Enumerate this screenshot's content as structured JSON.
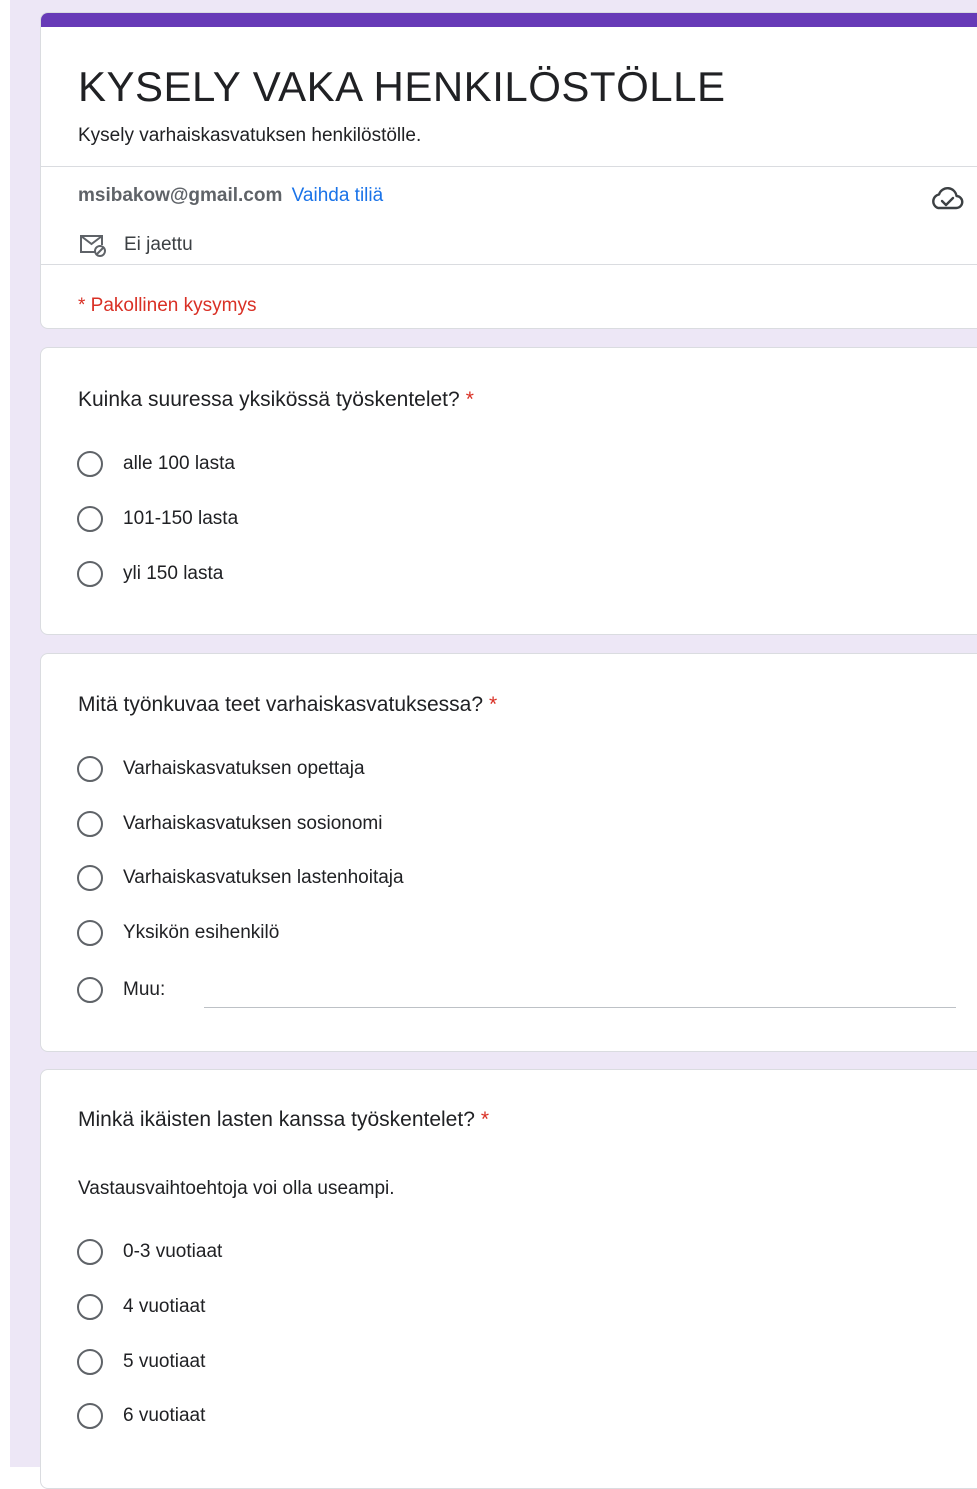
{
  "form": {
    "title": "KYSELY VAKA HENKILÖSTÖLLE",
    "description": "Kysely varhaiskasvatuksen henkilöstölle."
  },
  "account": {
    "email": "msibakow@gmail.com",
    "switch_label": "Vaihda tiliä",
    "share_status": "Ei jaettu",
    "cloud_icon": "cloud-saved-icon",
    "share_icon": "mail-not-shared-icon"
  },
  "required_note": "* Pakollinen kysymys",
  "required_star": "*",
  "questions": [
    {
      "title": "Kuinka suuressa yksikössä työskentelet?",
      "options": [
        "alle 100 lasta",
        "101-150 lasta",
        "yli 150 lasta"
      ]
    },
    {
      "title": "Mitä työnkuvaa teet varhaiskasvatuksessa?",
      "options": [
        "Varhaiskasvatuksen opettaja",
        "Varhaiskasvatuksen sosionomi",
        "Varhaiskasvatuksen lastenhoitaja",
        "Yksikön esihenkilö"
      ],
      "other_label": "Muu:"
    },
    {
      "title": "Minkä ikäisten lasten kanssa työskentelet?",
      "description": "Vastausvaihtoehtoja voi olla useampi.",
      "options": [
        "0-3 vuotiaat",
        "4 vuotiaat",
        "5 vuotiaat",
        "6 vuotiaat"
      ]
    }
  ],
  "colors": {
    "accent": "#673ab7",
    "background": "#ede7f6",
    "required": "#d93025",
    "link": "#1a73e8"
  }
}
